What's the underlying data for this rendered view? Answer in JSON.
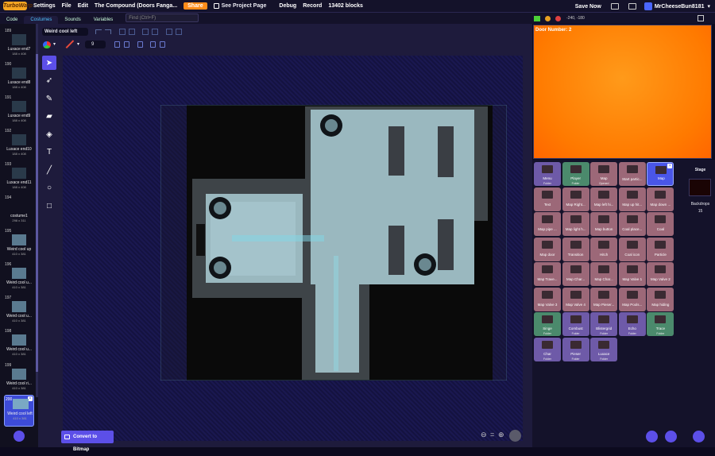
{
  "menubar": {
    "logo": "TurboWarp",
    "items": [
      "Settings",
      "File",
      "Edit"
    ],
    "project_title": "The Compound (Doors Fanga...",
    "share_label": "Share",
    "see_project_page": "See Project Page",
    "debug": "Debug",
    "record": "Record",
    "blocks_count": "13402 blocks",
    "save_now": "Save Now",
    "username": "MrCheeseBun8181"
  },
  "tabs": {
    "code": "Code",
    "costumes": "Costumes",
    "sounds": "Sounds",
    "variables": "Variables"
  },
  "find_placeholder": "Find (Ctrl+F)",
  "costumes": [
    {
      "num": "189",
      "name": "Luxace end7",
      "size": "188 x 408"
    },
    {
      "num": "190",
      "name": "Luxace end8",
      "size": "188 x 408"
    },
    {
      "num": "191",
      "name": "Luxace end9",
      "size": "188 x 408"
    },
    {
      "num": "192",
      "name": "Luxace end10",
      "size": "188 x 408"
    },
    {
      "num": "193",
      "name": "Luxace end11",
      "size": "188 x 408"
    },
    {
      "num": "194",
      "name": "costume1",
      "size": "298 x 311"
    },
    {
      "num": "195",
      "name": "Weird cool up",
      "size": "410 x 381"
    },
    {
      "num": "196",
      "name": "Weird cool u...",
      "size": "410 x 381"
    },
    {
      "num": "197",
      "name": "Weird cool u...",
      "size": "410 x 381"
    },
    {
      "num": "198",
      "name": "Weird cool u...",
      "size": "410 x 381"
    },
    {
      "num": "199",
      "name": "Weird cool ri...",
      "size": "410 x 381"
    },
    {
      "num": "200",
      "name": "Weird cool left",
      "size": "410 x 381",
      "selected": true
    }
  ],
  "editor": {
    "costume_name": "Weird cool left",
    "stroke_width": "9",
    "convert_button": "Convert to Bitmap",
    "zoom_reset": "="
  },
  "stage": {
    "coords": "-240, -180",
    "monitor": "Door Number: 2"
  },
  "sprites": [
    {
      "name": "Menu",
      "folder": "Folder",
      "type": "folder"
    },
    {
      "name": "Player",
      "folder": "Folder",
      "type": "folder"
    },
    {
      "name": "Map",
      "folder": "Opened",
      "type": "folder"
    },
    {
      "name": "Start partic...",
      "type": "sprite"
    },
    {
      "name": "Map",
      "type": "sprite",
      "selected": true
    },
    {
      "name": "Text",
      "type": "sprite"
    },
    {
      "name": "Map Right...",
      "type": "sprite"
    },
    {
      "name": "Map left hi...",
      "type": "sprite"
    },
    {
      "name": "Map up hit...",
      "type": "sprite"
    },
    {
      "name": "Map down ...",
      "type": "sprite"
    },
    {
      "name": "Map pipe ...",
      "type": "sprite"
    },
    {
      "name": "Map light h...",
      "type": "sprite"
    },
    {
      "name": "Map button",
      "type": "sprite"
    },
    {
      "name": "Coal place...",
      "type": "sprite"
    },
    {
      "name": "Coal",
      "type": "sprite"
    },
    {
      "name": "Map door",
      "type": "sprite"
    },
    {
      "name": "Transition",
      "type": "sprite"
    },
    {
      "name": "Hitch",
      "type": "sprite"
    },
    {
      "name": "Coal icon",
      "type": "sprite"
    },
    {
      "name": "Particle",
      "type": "sprite"
    },
    {
      "name": "Map Trave...",
      "type": "sprite"
    },
    {
      "name": "Map Char...",
      "type": "sprite"
    },
    {
      "name": "Map Char...",
      "type": "sprite"
    },
    {
      "name": "Map Valve 1",
      "type": "sprite"
    },
    {
      "name": "Map Valve 2",
      "type": "sprite"
    },
    {
      "name": "Map Valve 3",
      "type": "sprite"
    },
    {
      "name": "Map Valve 4",
      "type": "sprite"
    },
    {
      "name": "Map Pieser...",
      "type": "sprite"
    },
    {
      "name": "Map Pools...",
      "type": "sprite"
    },
    {
      "name": "Map hiding",
      "type": "sprite"
    },
    {
      "name": "Singe",
      "folder": "Folder",
      "type": "folder"
    },
    {
      "name": "Combust",
      "folder": "Folder",
      "type": "folder"
    },
    {
      "name": "Blistergrid",
      "folder": "Folder",
      "type": "folder"
    },
    {
      "name": "Echo",
      "folder": "Folder",
      "type": "folder"
    },
    {
      "name": "Trace",
      "folder": "Folder",
      "type": "folder"
    },
    {
      "name": "Char",
      "folder": "Folder",
      "type": "folder"
    },
    {
      "name": "Pieser",
      "folder": "Folder",
      "type": "folder"
    },
    {
      "name": "Luxace",
      "folder": "Folder",
      "type": "folder"
    }
  ],
  "stage_panel": {
    "label": "Stage",
    "backdrops_label": "Backdrops",
    "backdrops_count": "15"
  },
  "colors": {
    "accent": "#5c4fe8",
    "orange": "#ff8c1a",
    "sprite_tile": "#9c6878",
    "folder_green": "#4b8a6c",
    "folder_purple": "#6e5aa8"
  }
}
